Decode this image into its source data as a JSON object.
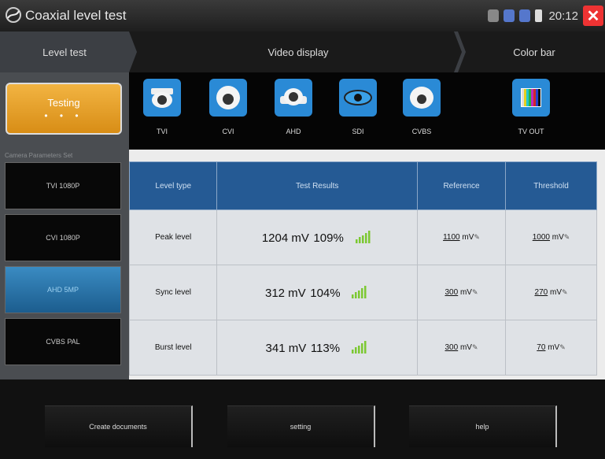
{
  "app": {
    "title": "Coaxial level test",
    "time": "20:12"
  },
  "tabs": [
    "Level test",
    "Video display",
    "Color bar"
  ],
  "status_button": {
    "label": "Testing",
    "dots": "• • •"
  },
  "camera_params_title": "Camera Parameters Set",
  "camera_params": [
    "TVI 1080P",
    "CVI 1080P",
    "AHD 5MP",
    "CVBS PAL"
  ],
  "selected_param": "AHD 5MP",
  "cameras": [
    "TVI",
    "CVI",
    "AHD",
    "SDI",
    "CVBS"
  ],
  "tvout": "TV OUT",
  "table": {
    "headers": [
      "Level type",
      "Test Results",
      "Reference",
      "Threshold"
    ],
    "rows": [
      {
        "type": "Peak level",
        "value": "1204 mV",
        "percent": "109%",
        "ref": "1100",
        "ref_unit": "mV",
        "thr": "1000",
        "thr_unit": "mV"
      },
      {
        "type": "Sync level",
        "value": "312 mV",
        "percent": "104%",
        "ref": "300",
        "ref_unit": "mV",
        "thr": "270",
        "thr_unit": "mV"
      },
      {
        "type": "Burst level",
        "value": "341 mV",
        "percent": "113%",
        "ref": "300",
        "ref_unit": "mV",
        "thr": "70",
        "thr_unit": "mV"
      }
    ]
  },
  "bottom_buttons": [
    "Create documents",
    "setting",
    "help"
  ],
  "colors": {
    "accent_blue": "#255a94",
    "testing_orange": "#e8a22a",
    "signal_green": "#7cc832"
  }
}
